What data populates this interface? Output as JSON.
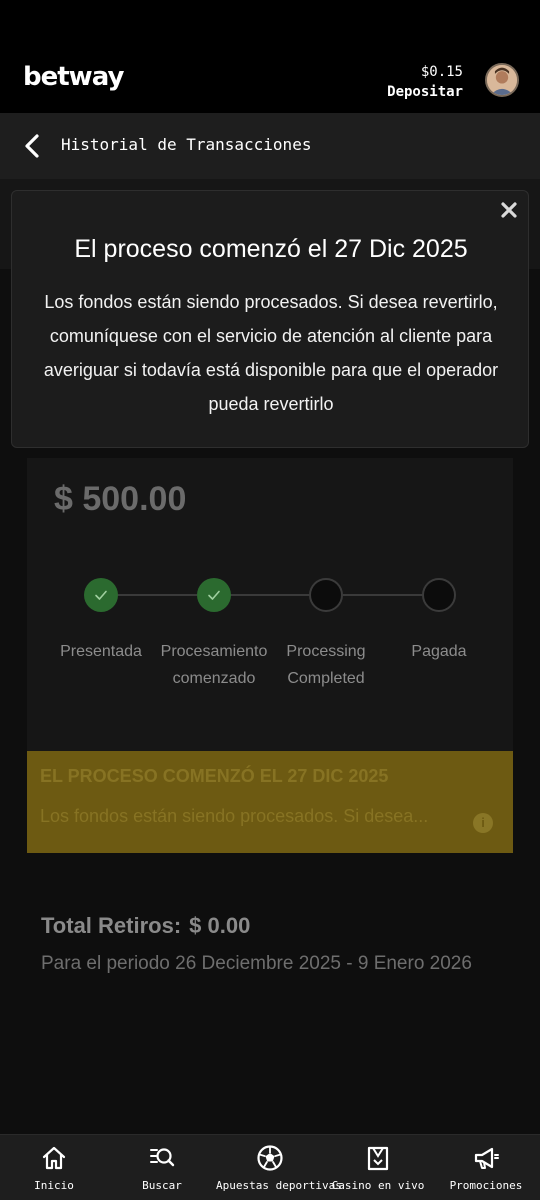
{
  "header": {
    "brand": "betway",
    "balance": "$0.15",
    "deposit_label": "Depositar"
  },
  "subheader": {
    "title": "Historial de Transacciones"
  },
  "transaction": {
    "amount": "$ 500.00",
    "steps": [
      {
        "label_line1": "Presentada",
        "label_line2": "",
        "status": "done"
      },
      {
        "label_line1": "Procesamiento",
        "label_line2": "comenzado",
        "status": "done"
      },
      {
        "label_line1": "Processing",
        "label_line2": "Completed",
        "status": "pending"
      },
      {
        "label_line1": "Pagada",
        "label_line2": "",
        "status": "pending"
      }
    ],
    "notice": {
      "title": "EL PROCESO COMENZÓ EL 27 DIC 2025",
      "text": "Los fondos están siendo procesados. Si desea...",
      "info_icon_glyph": "i"
    }
  },
  "totals": {
    "label": "Total Retiros:",
    "value": "$ 0.00",
    "period": "Para el periodo 26 Deciembre 2025 - 9 Enero 2026"
  },
  "popup": {
    "title": "El proceso comenzó el 27 Dic 2025",
    "body": "Los fondos están siendo procesados. Si desea revertirlo, comuníquese con el servicio de atención al cliente para averiguar si todavía está disponible para que el operador pueda revertirlo"
  },
  "bottom_nav": [
    {
      "label": "Inicio",
      "icon": "home-icon"
    },
    {
      "label": "Buscar",
      "icon": "search-icon"
    },
    {
      "label": "Apuestas deportivas",
      "icon": "soccer-ball-icon"
    },
    {
      "label": "Casino en vivo",
      "icon": "dealer-icon"
    },
    {
      "label": "Promociones",
      "icon": "megaphone-icon"
    }
  ],
  "colors": {
    "step_done": "#2b6a2f",
    "notice_bg": "#6d5a12",
    "popup_bg": "#1c1c1c"
  }
}
